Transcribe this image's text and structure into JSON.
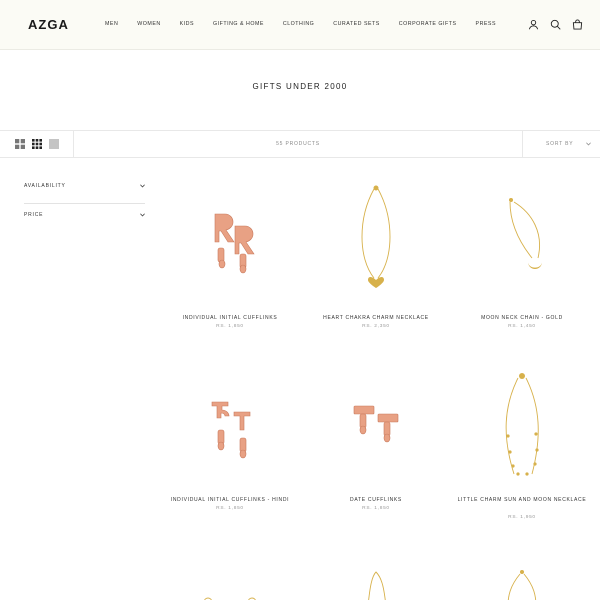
{
  "header": {
    "logo": "AZGA",
    "nav": [
      "MEN",
      "WOMEN",
      "KIDS",
      "GIFTING & HOME",
      "CLOTHING",
      "CURATED SETS",
      "CORPORATE GIFTS",
      "PRESS"
    ],
    "icons": [
      "account-icon",
      "search-icon",
      "cart-icon"
    ]
  },
  "page": {
    "title": "GIFTS UNDER 2000"
  },
  "toolbar": {
    "products_count": "55 PRODUCTS",
    "sort_label": "SORT BY"
  },
  "filters": [
    "AVAILABILITY",
    "PRICE"
  ],
  "products": [
    {
      "name": "INDIVIDUAL INITIAL CUFFLINKS",
      "price": "RS. 1,850"
    },
    {
      "name": "HEART CHAKRA CHARM NECKLACE",
      "price": "RS. 2,350"
    },
    {
      "name": "MOON NECK CHAIN - GOLD",
      "price": "RS. 1,450"
    },
    {
      "name": "INDIVIDUAL INITIAL CUFFLINKS - HINDI",
      "price": "RS. 1,850"
    },
    {
      "name": "DATE CUFFLINKS",
      "price": "RS. 1,850"
    },
    {
      "name": "LITTLE CHARM SUN AND MOON NECKLACE",
      "price": "RS. 1,950"
    }
  ],
  "colors": {
    "header_bg": "#fbfbf5",
    "rose_gold": "#e2987a",
    "gold": "#d7b14b"
  }
}
